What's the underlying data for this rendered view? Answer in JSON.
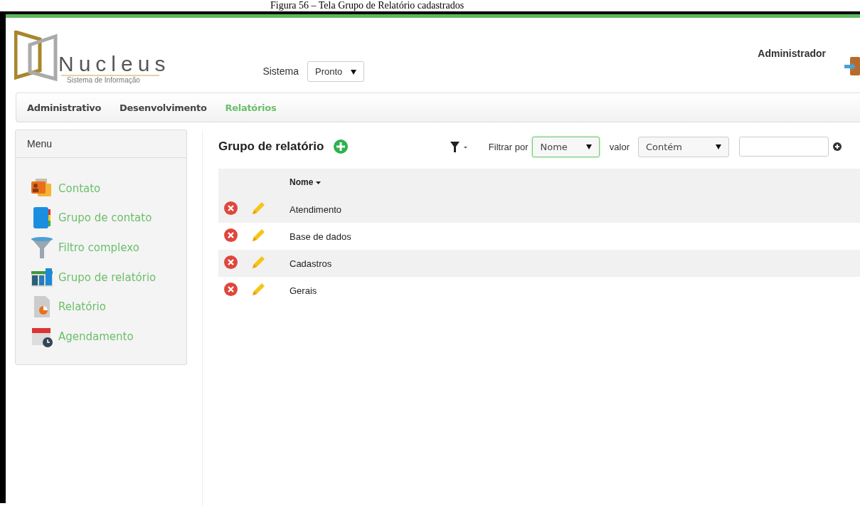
{
  "caption": "Figura 56 – Tela Grupo de Relatório cadastrados",
  "header": {
    "logo_name": "Nucleus",
    "logo_tagline": "Sistema de Informação",
    "system_label": "Sistema",
    "system_value": "Pronto",
    "user": "Administrador"
  },
  "nav": [
    {
      "label": "Administrativo",
      "selected": false
    },
    {
      "label": "Desenvolvimento",
      "selected": false
    },
    {
      "label": "Relatórios",
      "selected": true
    }
  ],
  "sidebar": {
    "title": "Menu",
    "items": [
      {
        "label": "Contato",
        "kind": "contact"
      },
      {
        "label": "Grupo de contato",
        "kind": "book"
      },
      {
        "label": "Filtro complexo",
        "kind": "funnel"
      },
      {
        "label": "Grupo de relatório",
        "kind": "chartgroup"
      },
      {
        "label": "Relatório",
        "kind": "report"
      },
      {
        "label": "Agendamento",
        "kind": "calendar"
      }
    ]
  },
  "content": {
    "title": "Grupo de relatório",
    "filter_label": "Filtrar por",
    "filter_field": "Nome",
    "value_label": "valor",
    "value_operator": "Contém",
    "table": {
      "columns": [
        {
          "label": "Nome"
        }
      ],
      "rows": [
        {
          "name": "Atendimento"
        },
        {
          "name": "Base de dados"
        },
        {
          "name": "Cadastros"
        },
        {
          "name": "Gerais"
        }
      ]
    }
  }
}
